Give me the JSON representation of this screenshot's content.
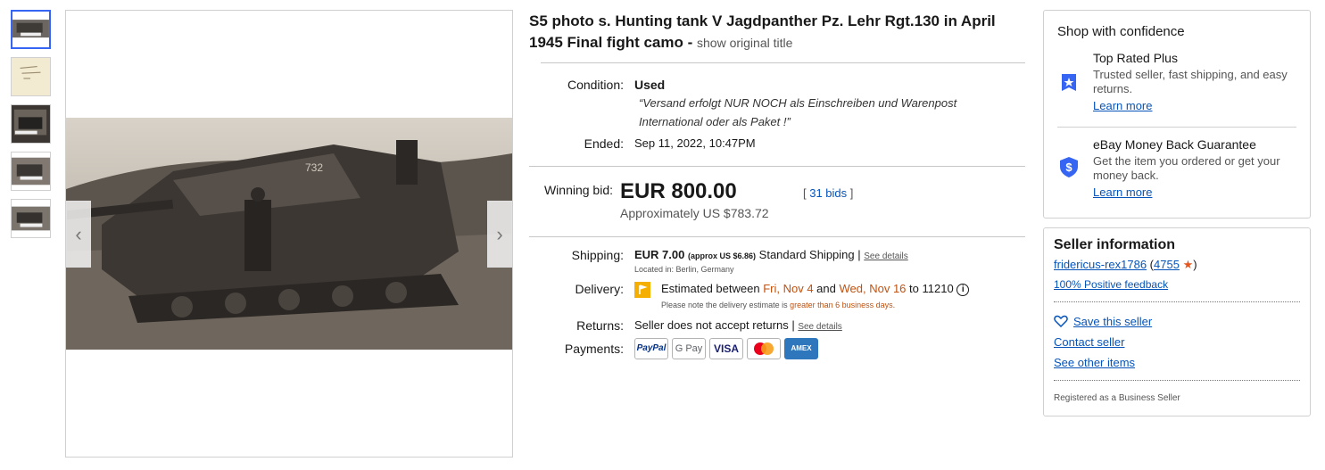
{
  "listing": {
    "title": "S5 photo s. Hunting tank V Jagdpanther Pz. Lehr Rgt.130 in April 1945 Final fight camo -",
    "show_original": "show original title",
    "watermark": "fridericus-rex1786"
  },
  "details": {
    "condition_label": "Condition:",
    "condition_value": "Used",
    "quote_text": "“Versand erfolgt NUR NOCH als Einschreiben und Warenpost International oder als Paket !”",
    "ended_label": "Ended:",
    "ended_value": "Sep 11, 2022, 10:47PM",
    "winning_label": "Winning bid:",
    "winning_price": "EUR 800.00",
    "bids": "31 bids",
    "approx": "Approximately US $783.72",
    "shipping_label": "Shipping:",
    "shipping_price": "EUR 7.00",
    "shipping_approx": "(approx US $6.86)",
    "shipping_method": "Standard Shipping",
    "see_details": "See details",
    "located": "Located in: Berlin, Germany",
    "delivery_label": "Delivery:",
    "delivery_pre": "Estimated between",
    "delivery_from": "Fri, Nov 4",
    "delivery_and": "and",
    "delivery_to": "Wed, Nov 16",
    "delivery_zip": "to 11210",
    "delivery_note_pre": "Please note the delivery estimate is",
    "delivery_note_hl": "greater than 6 business days.",
    "returns_label": "Returns:",
    "returns_value": "Seller does not accept returns",
    "payments_label": "Payments:",
    "payments": [
      "PayPal",
      "G Pay",
      "VISA",
      "mastercard",
      "AMEX"
    ]
  },
  "confidence": {
    "heading": "Shop with confidence",
    "top_rated_title": "Top Rated Plus",
    "top_rated_desc": "Trusted seller, fast shipping, and easy returns.",
    "top_rated_link": "Learn more",
    "mbg_title": "eBay Money Back Guarantee",
    "mbg_desc": "Get the item you ordered or get your money back.",
    "mbg_link": "Learn more"
  },
  "seller": {
    "heading": "Seller information",
    "name": "fridericus-rex1786",
    "feedback_count": "4755",
    "positive": "100% Positive feedback",
    "save": "Save this seller",
    "contact": "Contact seller",
    "other": "See other items",
    "registered": "Registered as a Business Seller"
  },
  "colors": {
    "link": "#0654ba",
    "accent": "#3665f3",
    "orange": "#c1510f"
  }
}
